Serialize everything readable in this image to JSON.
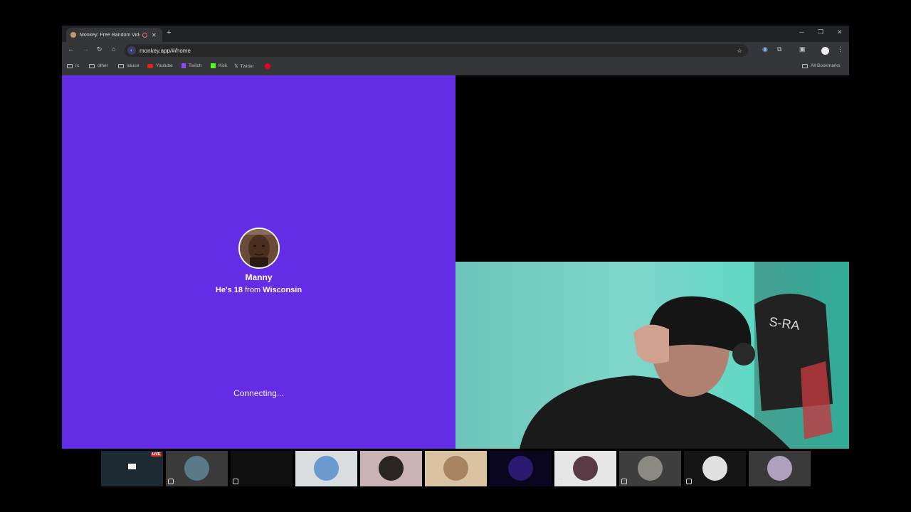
{
  "browser": {
    "tab": {
      "title": "Monkey: Free Random Vide",
      "close": "✕"
    },
    "new_tab": "+",
    "window_controls": {
      "minimize": "─",
      "restore": "❐",
      "close": "✕"
    },
    "nav": {
      "back": "←",
      "forward": "→",
      "reload": "↻",
      "home": "⌂"
    },
    "url": "monkey.app/#/home",
    "bookmarks": [
      {
        "label": "rc",
        "icon": "folder-icon"
      },
      {
        "label": "other",
        "icon": "folder-icon"
      },
      {
        "label": "sauce",
        "icon": "folder-icon"
      },
      {
        "label": "Youtube",
        "icon": "youtube-icon"
      },
      {
        "label": "Twitch",
        "icon": "twitch-icon"
      },
      {
        "label": "Kick",
        "icon": "kick-icon"
      },
      {
        "label": "Twitter",
        "icon": "x-icon"
      },
      {
        "label": "",
        "icon": "pinterest-icon"
      }
    ],
    "all_bookmarks": "All Bookmarks"
  },
  "match": {
    "name": "Manny",
    "prefix": "He's",
    "age": "18",
    "from_word": "from",
    "location": "Wisconsin",
    "status": "Connecting..."
  },
  "thumbnails": {
    "live_badge": "LIVE",
    "count": 11
  },
  "colors": {
    "pane_purple": "#652ce6",
    "browser_chrome": "#35363a",
    "webcam_teal": "#6fd0c2"
  }
}
